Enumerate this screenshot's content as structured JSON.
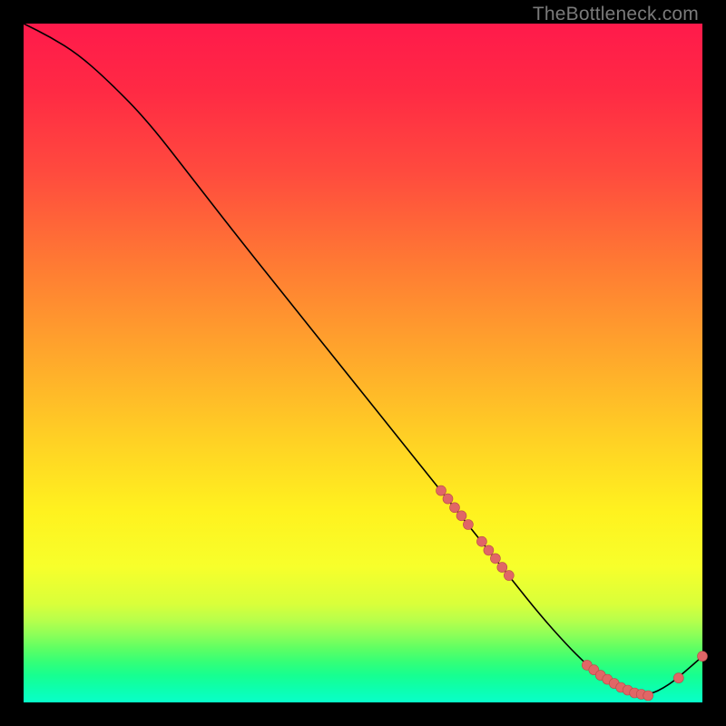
{
  "watermark": "TheBottleneck.com",
  "chart_data": {
    "type": "line",
    "title": "",
    "xlabel": "",
    "ylabel": "",
    "xlim": [
      0,
      100
    ],
    "ylim": [
      0,
      100
    ],
    "grid": false,
    "legend": false,
    "series": [
      {
        "name": "bottleneck-curve",
        "x": [
          0,
          4,
          8,
          12,
          18,
          25,
          32,
          40,
          48,
          56,
          62,
          68,
          72,
          76,
          80,
          83,
          86,
          89,
          92,
          95,
          98,
          100
        ],
        "y": [
          100,
          98,
          95.5,
          92,
          86,
          77,
          68,
          58,
          48,
          38,
          30.5,
          23,
          18,
          13,
          8.5,
          5.5,
          3.2,
          1.6,
          1.0,
          2.5,
          5.0,
          6.8
        ]
      }
    ],
    "markers": [
      {
        "cluster": "segment-1",
        "points": [
          {
            "x": 61.5,
            "y": 31.2
          },
          {
            "x": 62.5,
            "y": 30.0
          },
          {
            "x": 63.5,
            "y": 28.7
          },
          {
            "x": 64.5,
            "y": 27.5
          },
          {
            "x": 65.5,
            "y": 26.2
          }
        ]
      },
      {
        "cluster": "segment-2",
        "points": [
          {
            "x": 67.5,
            "y": 23.7
          },
          {
            "x": 68.5,
            "y": 22.4
          },
          {
            "x": 69.5,
            "y": 21.2
          },
          {
            "x": 70.5,
            "y": 19.9
          },
          {
            "x": 71.5,
            "y": 18.7
          }
        ]
      },
      {
        "cluster": "floor",
        "points": [
          {
            "x": 83.0,
            "y": 5.5
          },
          {
            "x": 84.0,
            "y": 4.8
          },
          {
            "x": 85.0,
            "y": 4.0
          },
          {
            "x": 86.0,
            "y": 3.4
          },
          {
            "x": 87.0,
            "y": 2.8
          },
          {
            "x": 88.0,
            "y": 2.2
          },
          {
            "x": 89.0,
            "y": 1.8
          },
          {
            "x": 90.0,
            "y": 1.4
          },
          {
            "x": 91.0,
            "y": 1.2
          },
          {
            "x": 92.0,
            "y": 1.0
          }
        ]
      },
      {
        "cluster": "uptick",
        "points": [
          {
            "x": 96.5,
            "y": 3.6
          },
          {
            "x": 100.0,
            "y": 6.8
          }
        ]
      }
    ]
  }
}
